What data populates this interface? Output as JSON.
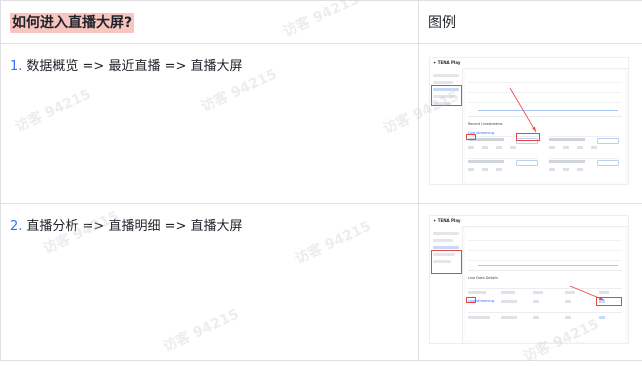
{
  "table": {
    "header": {
      "question": "如何进入直播大屏?",
      "example": "图例"
    },
    "rows": [
      {
        "number": "1.",
        "path": "数据概览 => 最近直播 => 直播大屏"
      },
      {
        "number": "2.",
        "path": "直播分析 => 直播明细 => 直播大屏"
      }
    ]
  },
  "watermark": "访客 94215",
  "thumbnails": {
    "first": {
      "logo": "✦ TENA Play",
      "section_label": "Recent Livestreams",
      "card_label": "Live streaming"
    },
    "second": {
      "logo": "✦ TENA Play",
      "section_label": "Live Data Details",
      "row_label": "Live streaming"
    }
  },
  "colors": {
    "header_highlight": "#f6c6bf",
    "list_number": "#3370ff",
    "annotation_red": "#e64545",
    "border": "#dee0e3"
  }
}
